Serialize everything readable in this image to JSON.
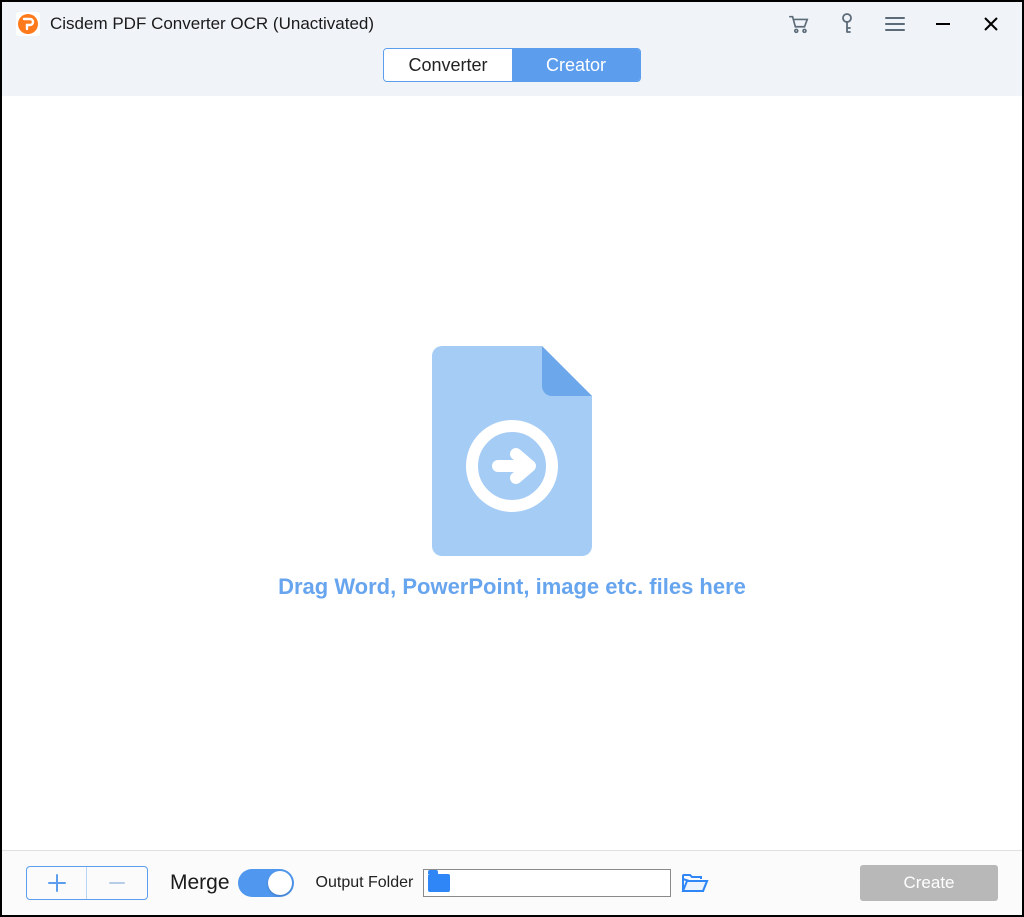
{
  "titleBar": {
    "title": "Cisdem PDF Converter OCR (Unactivated)"
  },
  "tabs": {
    "converter": "Converter",
    "creator": "Creator",
    "active": "creator"
  },
  "dropArea": {
    "hint": "Drag Word, PowerPoint, image etc. files here"
  },
  "bottom": {
    "mergeLabel": "Merge",
    "mergeOn": true,
    "outputLabel": "Output Folder",
    "outputPath": "",
    "createLabel": "Create"
  },
  "colors": {
    "accent": "#5c9ded",
    "dropIconFill": "#a5ccf5",
    "dropIconFold": "#6ba7ea",
    "hintText": "#67a5ee"
  }
}
